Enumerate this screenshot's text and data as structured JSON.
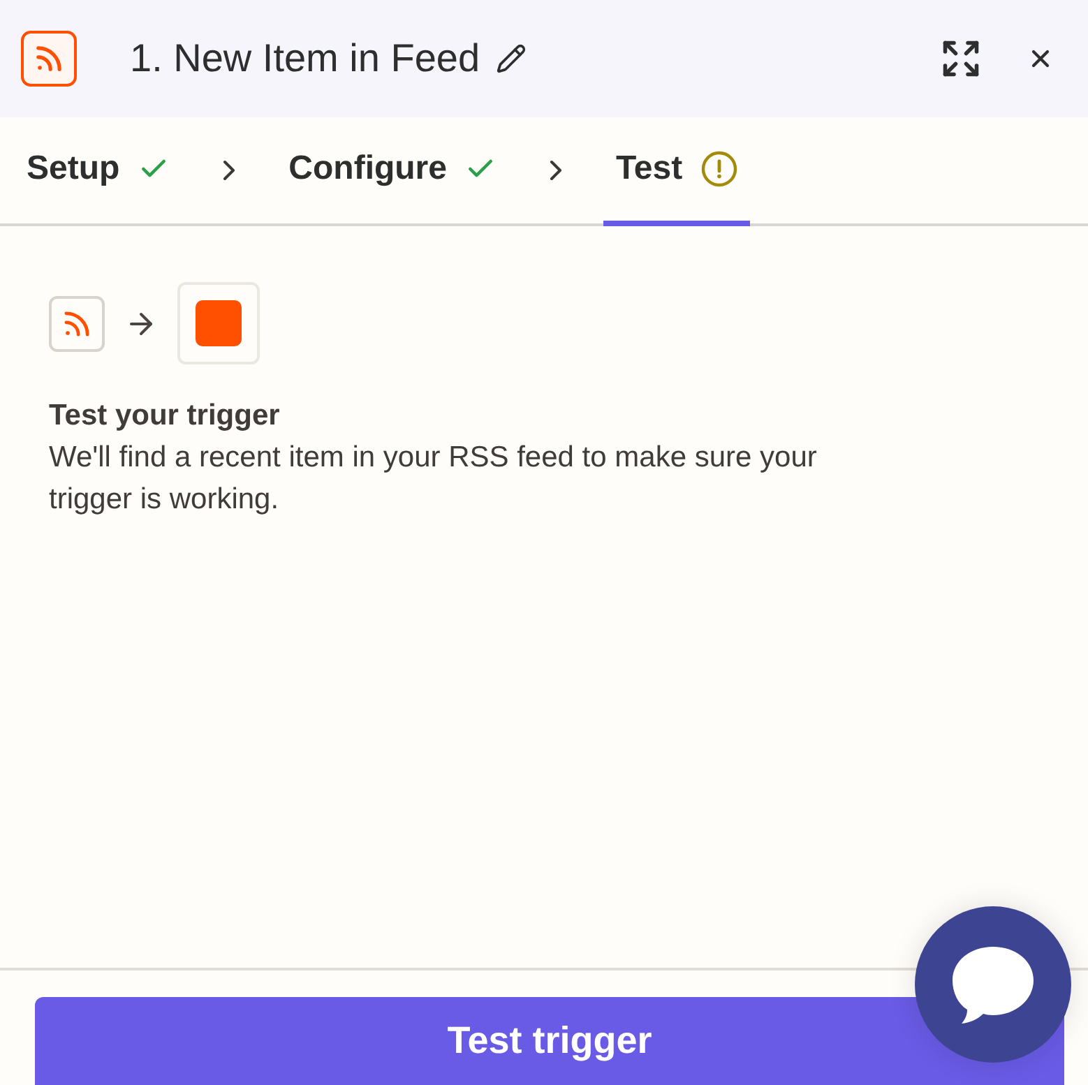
{
  "header": {
    "title": "1. New Item in Feed"
  },
  "steps": [
    {
      "label": "Setup",
      "kind": "check",
      "selected": false
    },
    {
      "label": "Configure",
      "kind": "check",
      "selected": false
    },
    {
      "label": "Test",
      "kind": "warning",
      "selected": true
    }
  ],
  "intro": {
    "title": "Test your trigger",
    "description": "We'll find a recent item in your RSS feed to make sure your trigger is working."
  },
  "footer": {
    "button": "Test trigger"
  }
}
